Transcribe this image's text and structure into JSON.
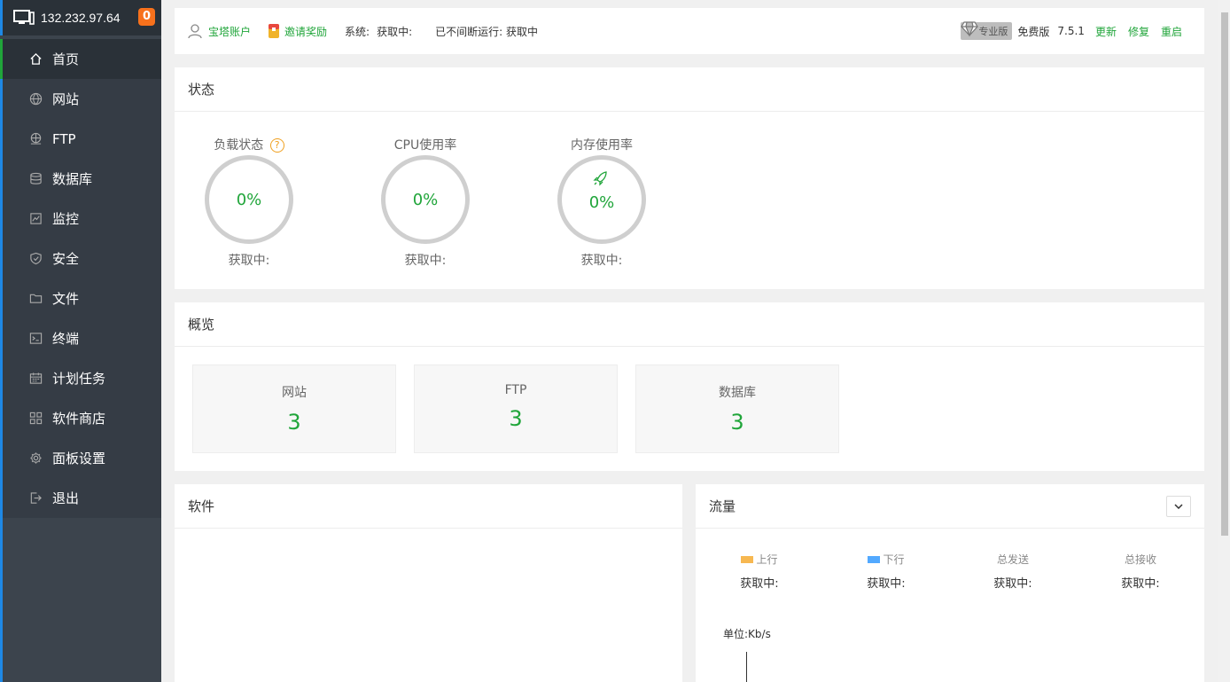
{
  "sidebar": {
    "ip": "132.232.97.64",
    "badge": "0",
    "items": [
      {
        "label": "首页",
        "icon": "home-icon"
      },
      {
        "label": "网站",
        "icon": "globe-icon"
      },
      {
        "label": "FTP",
        "icon": "ftp-icon"
      },
      {
        "label": "数据库",
        "icon": "database-icon"
      },
      {
        "label": "监控",
        "icon": "monitor-chart-icon"
      },
      {
        "label": "安全",
        "icon": "shield-icon"
      },
      {
        "label": "文件",
        "icon": "folder-icon"
      },
      {
        "label": "终端",
        "icon": "terminal-icon"
      },
      {
        "label": "计划任务",
        "icon": "calendar-icon"
      },
      {
        "label": "软件商店",
        "icon": "apps-grid-icon"
      },
      {
        "label": "面板设置",
        "icon": "gear-icon"
      },
      {
        "label": "退出",
        "icon": "logout-icon"
      }
    ]
  },
  "topbar": {
    "account": "宝塔账户",
    "invite": "邀请奖励",
    "system_label": "系统:",
    "system_value": "获取中:",
    "uptime": "已不间断运行: 获取中",
    "pro": "专业版",
    "edition": "免费版",
    "version": "7.5.1",
    "update": "更新",
    "repair": "修复",
    "restart": "重启"
  },
  "status": {
    "title": "状态",
    "gauges": [
      {
        "label": "负载状态",
        "value": "0%",
        "sub": "获取中:"
      },
      {
        "label": "CPU使用率",
        "value": "0%",
        "sub": "获取中:"
      },
      {
        "label": "内存使用率",
        "value": "0%",
        "sub": "获取中:"
      }
    ]
  },
  "overview": {
    "title": "概览",
    "boxes": [
      {
        "label": "网站",
        "value": "3"
      },
      {
        "label": "FTP",
        "value": "3"
      },
      {
        "label": "数据库",
        "value": "3"
      }
    ]
  },
  "software": {
    "title": "软件"
  },
  "traffic": {
    "title": "流量",
    "cols": [
      {
        "label": "上行",
        "value": "获取中:",
        "color": "#f7b851"
      },
      {
        "label": "下行",
        "value": "获取中:",
        "color": "#52a9ff"
      },
      {
        "label": "总发送",
        "value": "获取中:"
      },
      {
        "label": "总接收",
        "value": "获取中:"
      }
    ],
    "unit": "单位:Kb/s"
  }
}
